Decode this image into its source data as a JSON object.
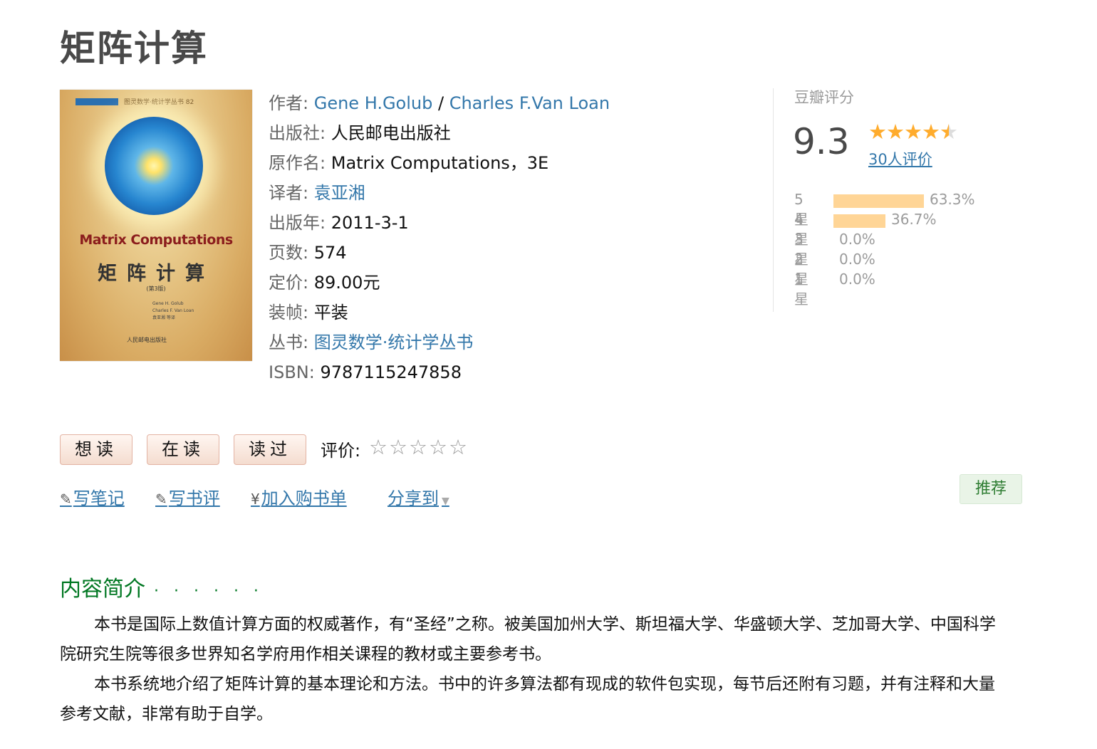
{
  "title": "矩阵计算",
  "cover": {
    "series": "图灵数学·统计学丛书 82",
    "title_en": "Matrix Computations",
    "title_zh": "矩阵计算",
    "edition": "(第3版)",
    "authors": [
      "Gene H. Golub",
      "Charles F. Van Loan",
      "袁亚湘 等译"
    ],
    "publisher": "人民邮电出版社"
  },
  "info": {
    "author_label": "作者:",
    "author1": "Gene H.Golub",
    "author_sep": " / ",
    "author2": "Charles F.Van Loan",
    "publisher_label": "出版社:",
    "publisher": "人民邮电出版社",
    "original_label": "原作名:",
    "original": "Matrix Computations，3E",
    "translator_label": "译者:",
    "translator": "袁亚湘",
    "date_label": "出版年:",
    "date": "2011-3-1",
    "pages_label": "页数:",
    "pages": "574",
    "price_label": "定价:",
    "price": "89.00元",
    "binding_label": "装帧:",
    "binding": "平装",
    "series_label": "丛书:",
    "series": "图灵数学·统计学丛书",
    "isbn_label": "ISBN:",
    "isbn": "9787115247858"
  },
  "rating": {
    "label": "豆瓣评分",
    "score": "9.3",
    "stars_value": 4.5,
    "count": "30人评价",
    "rows": [
      {
        "star": "5星",
        "percent": "63.3%",
        "value": 63.3
      },
      {
        "star": "4星",
        "percent": "36.7%",
        "value": 36.7
      },
      {
        "star": "3星",
        "percent": "0.0%",
        "value": 0
      },
      {
        "star": "2星",
        "percent": "0.0%",
        "value": 0
      },
      {
        "star": "1星",
        "percent": "0.0%",
        "value": 0
      }
    ]
  },
  "actions": {
    "want": "想读",
    "reading": "在读",
    "read": "读过",
    "rate_label": "评价:",
    "note": "写笔记",
    "review": "写书评",
    "cart": "加入购书单",
    "share": "分享到",
    "recommend": "推荐"
  },
  "intro": {
    "heading": "内容简介",
    "dots": "· · · · · ·",
    "p1": "本书是国际上数值计算方面的权威著作，有“圣经”之称。被美国加州大学、斯坦福大学、华盛顿大学、芝加哥大学、中国科学院研究生院等很多世界知名学府用作相关课程的教材或主要参考书。",
    "p2": "本书系统地介绍了矩阵计算的基本理论和方法。书中的许多算法都有现成的软件包实现，每节后还附有习题，并有注释和大量参考文献，非常有助于自学。"
  },
  "colors": {
    "link": "#3377aa",
    "star": "#ffac2d",
    "bar": "#ffd596",
    "green": "#007722"
  }
}
